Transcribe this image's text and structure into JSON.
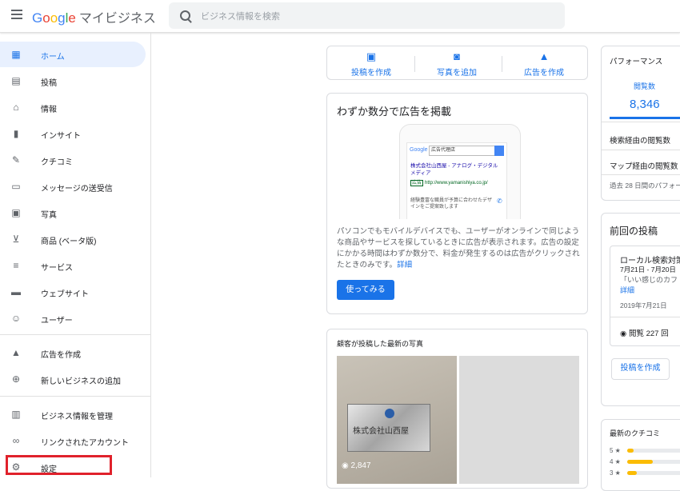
{
  "header": {
    "logo_parts": [
      "G",
      "o",
      "o",
      "g",
      "l",
      "e"
    ],
    "app_name": "マイビジネス",
    "search_placeholder": "ビジネス情報を検索"
  },
  "sidebar": {
    "items": [
      {
        "label": "ホーム",
        "icon": "dashboard-icon",
        "active": true
      },
      {
        "label": "投稿",
        "icon": "posts-icon"
      },
      {
        "label": "情報",
        "icon": "store-icon"
      },
      {
        "label": "インサイト",
        "icon": "bar-chart-icon"
      },
      {
        "label": "クチコミ",
        "icon": "reviews-icon"
      },
      {
        "label": "メッセージの送受信",
        "icon": "message-icon"
      },
      {
        "label": "写真",
        "icon": "photo-icon"
      },
      {
        "label": "商品 (ベータ版)",
        "icon": "basket-icon"
      },
      {
        "label": "サービス",
        "icon": "list-icon"
      },
      {
        "label": "ウェブサイト",
        "icon": "website-icon"
      },
      {
        "label": "ユーザー",
        "icon": "add-person-icon"
      }
    ],
    "items2": [
      {
        "label": "広告を作成",
        "icon": "google-ads-icon"
      },
      {
        "label": "新しいビジネスの追加",
        "icon": "add-location-icon"
      }
    ],
    "items3": [
      {
        "label": "ビジネス情報を管理",
        "icon": "building-icon"
      },
      {
        "label": "リンクされたアカウント",
        "icon": "link-icon"
      },
      {
        "label": "設定",
        "icon": "gear-icon"
      }
    ]
  },
  "quick_actions": [
    {
      "label": "投稿を作成",
      "icon": "post-create-icon"
    },
    {
      "label": "写真を追加",
      "icon": "add-photo-icon"
    },
    {
      "label": "広告を作成",
      "icon": "google-ads-icon"
    }
  ],
  "ad_card": {
    "title": "わずか数分で広告を掲載",
    "mock_google": "Google",
    "mock_query": "広告代理店",
    "mock_ad_title": "株式会社山西屋 - アナログ・デジタルメディア",
    "mock_ad_badge": "広告",
    "mock_ad_url": "http://www.yamanishiya.co.jp/",
    "mock_ad_desc": "経験豊富な職員が予算に合わせたデザインをご提案致します",
    "body": "パソコンでもモバイルデバイスでも、ユーザーがオンラインで同じような商品やサービスを探しているときに広告が表示されます。広告の設定にかかる時間はわずか数分で、料金が発生するのは広告がクリックされたときのみです。",
    "link": "詳細",
    "button": "使ってみる"
  },
  "photos_card": {
    "title": "顧客が投稿した最新の写真",
    "plate_text": "株式会社山西屋",
    "views": "2,847"
  },
  "performance": {
    "title": "パフォーマンス",
    "metric_label": "閲覧数",
    "metric_value": "8,346",
    "row1": "検索経由の閲覧数",
    "row2": "マップ経由の閲覧数",
    "note": "過去 28 日間のパフォー"
  },
  "last_post": {
    "title": "前回の投稿",
    "post_title": "ローカル検索対策",
    "date_range": "7月21日 - 7月20日",
    "snippet": "「いい感じのカフ",
    "more": "詳細",
    "date": "2019年7月21日",
    "views": "閲覧 227 回",
    "button": "投稿を作成"
  },
  "reviews": {
    "title": "最新のクチコミ",
    "rows": [
      {
        "stars": "5",
        "fill": 0.1
      },
      {
        "stars": "4",
        "fill": 0.4
      },
      {
        "stars": "3",
        "fill": 0.15
      }
    ]
  }
}
